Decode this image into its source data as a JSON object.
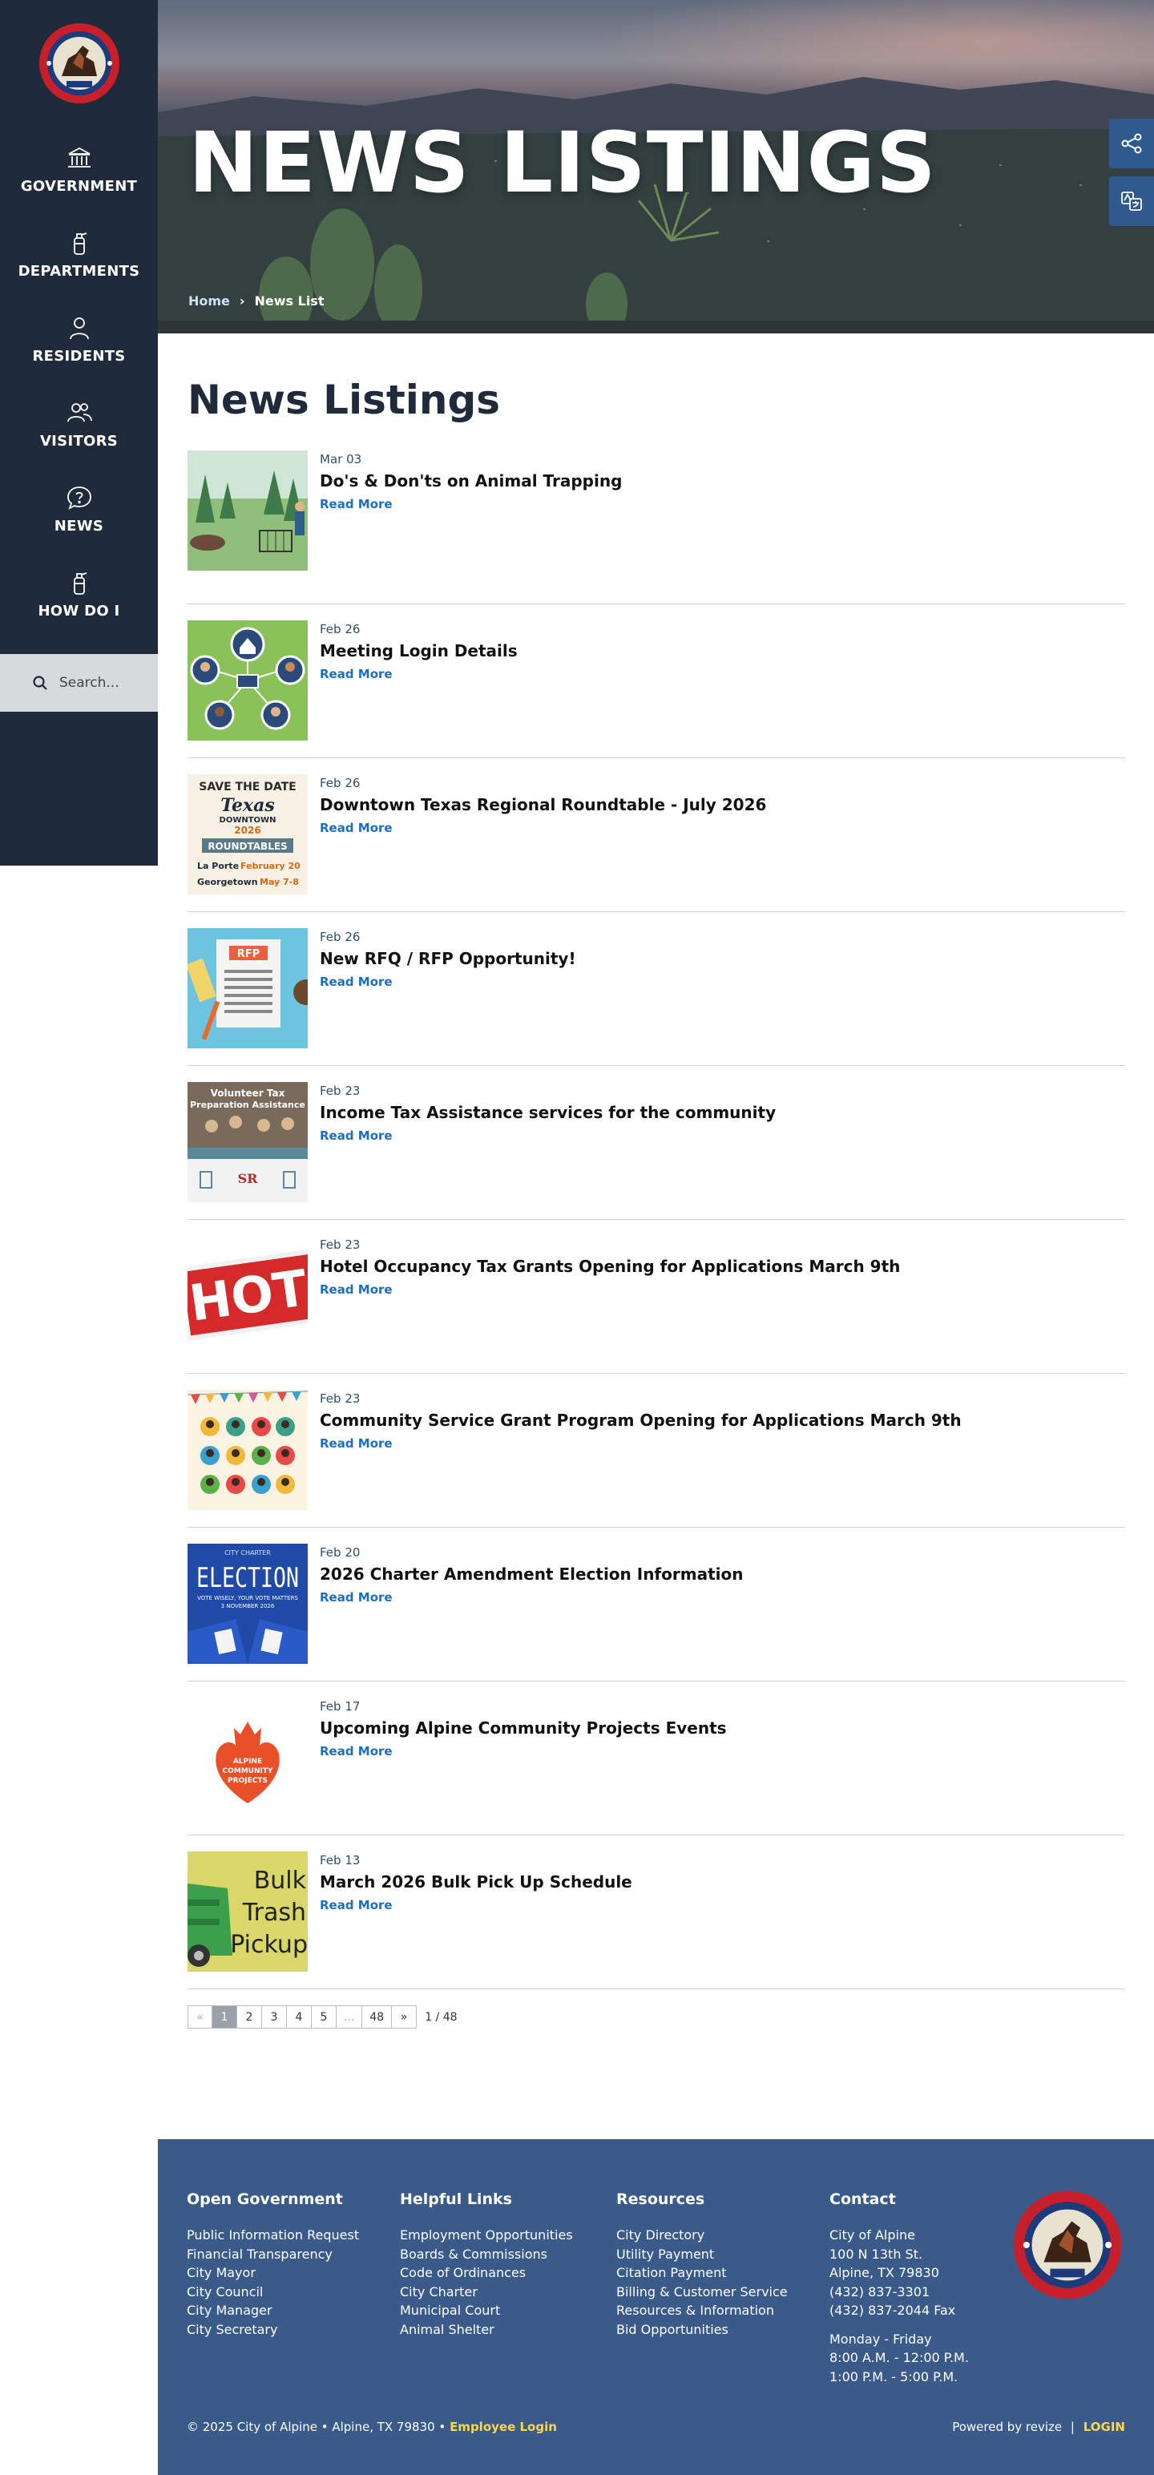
{
  "sidebar": {
    "seal_text": "CITY OF ALPINE",
    "seal_year": "1882",
    "items": [
      {
        "label": "GOVERNMENT",
        "icon": "building-icon"
      },
      {
        "label": "DEPARTMENTS",
        "icon": "fire-extinguisher-icon"
      },
      {
        "label": "RESIDENTS",
        "icon": "person-icon"
      },
      {
        "label": "VISITORS",
        "icon": "people-icon"
      },
      {
        "label": "NEWS",
        "icon": "chat-question-icon"
      },
      {
        "label": "HOW DO I",
        "icon": "fire-extinguisher-icon"
      }
    ],
    "search_placeholder": "Search..."
  },
  "hero": {
    "title": "NEWS LISTINGS",
    "breadcrumb": {
      "home": "Home",
      "separator": "›",
      "current": "News List"
    }
  },
  "main": {
    "title": "News Listings",
    "items": [
      {
        "date": "Mar 03",
        "title": "Do's & Don'ts on Animal Trapping",
        "read_more": "Read More",
        "thumb": "animal-trapping"
      },
      {
        "date": "Feb 26",
        "title": "Meeting Login Details",
        "read_more": "Read More",
        "thumb": "meeting-login"
      },
      {
        "date": "Feb 26",
        "title": "Downtown Texas Regional Roundtable - July 2026",
        "read_more": "Read More",
        "thumb": "save-the-date"
      },
      {
        "date": "Feb 26",
        "title": "New RFQ / RFP Opportunity!",
        "read_more": "Read More",
        "thumb": "rfp"
      },
      {
        "date": "Feb 23",
        "title": "Income Tax Assistance services for the community",
        "read_more": "Read More",
        "thumb": "tax-assistance"
      },
      {
        "date": "Feb 23",
        "title": "Hotel Occupancy Tax Grants Opening for Applications March 9th",
        "read_more": "Read More",
        "thumb": "hot"
      },
      {
        "date": "Feb 23",
        "title": "Community Service Grant Program Opening for Applications March 9th",
        "read_more": "Read More",
        "thumb": "community-grant"
      },
      {
        "date": "Feb 20",
        "title": "2026 Charter Amendment Election Information",
        "read_more": "Read More",
        "thumb": "election"
      },
      {
        "date": "Feb 17",
        "title": "Upcoming Alpine Community Projects Events",
        "read_more": "Read More",
        "thumb": "community-projects"
      },
      {
        "date": "Feb 13",
        "title": "March 2026 Bulk Pick Up Schedule",
        "read_more": "Read More",
        "thumb": "bulk-trash"
      }
    ],
    "thumb_text": {
      "save_the_date": {
        "line1": "SAVE THE DATE",
        "line2": "Texas",
        "line3": "DOWNTOWN",
        "line4": "2026",
        "line5": "ROUNDTABLES",
        "line6a": "La Porte",
        "line6b": "February 20",
        "line7a": "Georgetown",
        "line7b": "May 7-8"
      },
      "rfp": "RFP",
      "tax": {
        "line1": "Volunteer Tax",
        "line2": "Preparation Assistance",
        "logo": "SR"
      },
      "hot": "HOT",
      "election": {
        "top": "CITY CHARTER",
        "big": "ELECTION",
        "sub1": "VOTE WISELY, YOUR VOTE MATTERS",
        "sub2": "3 NOVEMBER 2026"
      },
      "projects": {
        "line1": "ALPINE",
        "line2": "COMMUNITY",
        "line3": "PROJECTS"
      },
      "bulk": {
        "line1": "Bulk",
        "line2": "Trash",
        "line3": "Pickup"
      }
    },
    "pager": {
      "prev": "«",
      "pages": [
        "1",
        "2",
        "3",
        "4",
        "5"
      ],
      "dots": "...",
      "last": "48",
      "next": "»",
      "count": "1 / 48"
    }
  },
  "footer": {
    "cols": [
      {
        "heading": "Open Government",
        "links": [
          "Public Information Request",
          "Financial Transparency",
          "City Mayor",
          "City Council",
          "City Manager",
          "City Secretary"
        ]
      },
      {
        "heading": "Helpful Links",
        "links": [
          "Employment Opportunities",
          "Boards & Commissions",
          "Code of Ordinances",
          "City Charter",
          "Municipal Court",
          "Animal Shelter"
        ]
      },
      {
        "heading": "Resources",
        "links": [
          "City Directory",
          "Utility Payment",
          "Citation Payment",
          "Billing & Customer Service",
          "Resources & Information",
          "Bid Opportunities"
        ]
      }
    ],
    "contact": {
      "heading": "Contact",
      "lines": [
        "City of Alpine",
        "100 N 13th St.",
        "Alpine, TX 79830",
        "(432) 837-3301",
        "(432) 837-2044 Fax"
      ],
      "hours": [
        "Monday - Friday",
        "8:00 A.M. - 12:00 P.M.",
        "1:00 P.M. - 5:00 P.M."
      ]
    },
    "copyright": "© 2025 City of Alpine • Alpine, TX 79830 •",
    "employee_login": "Employee Login",
    "powered_by": "Powered by revize",
    "divider": "|",
    "login": "LOGIN"
  },
  "colors": {
    "sidebar": "#1f2a3a",
    "footer": "#3a5a8a",
    "link": "#1a6fbf",
    "accent_gold": "#ffd54a"
  }
}
